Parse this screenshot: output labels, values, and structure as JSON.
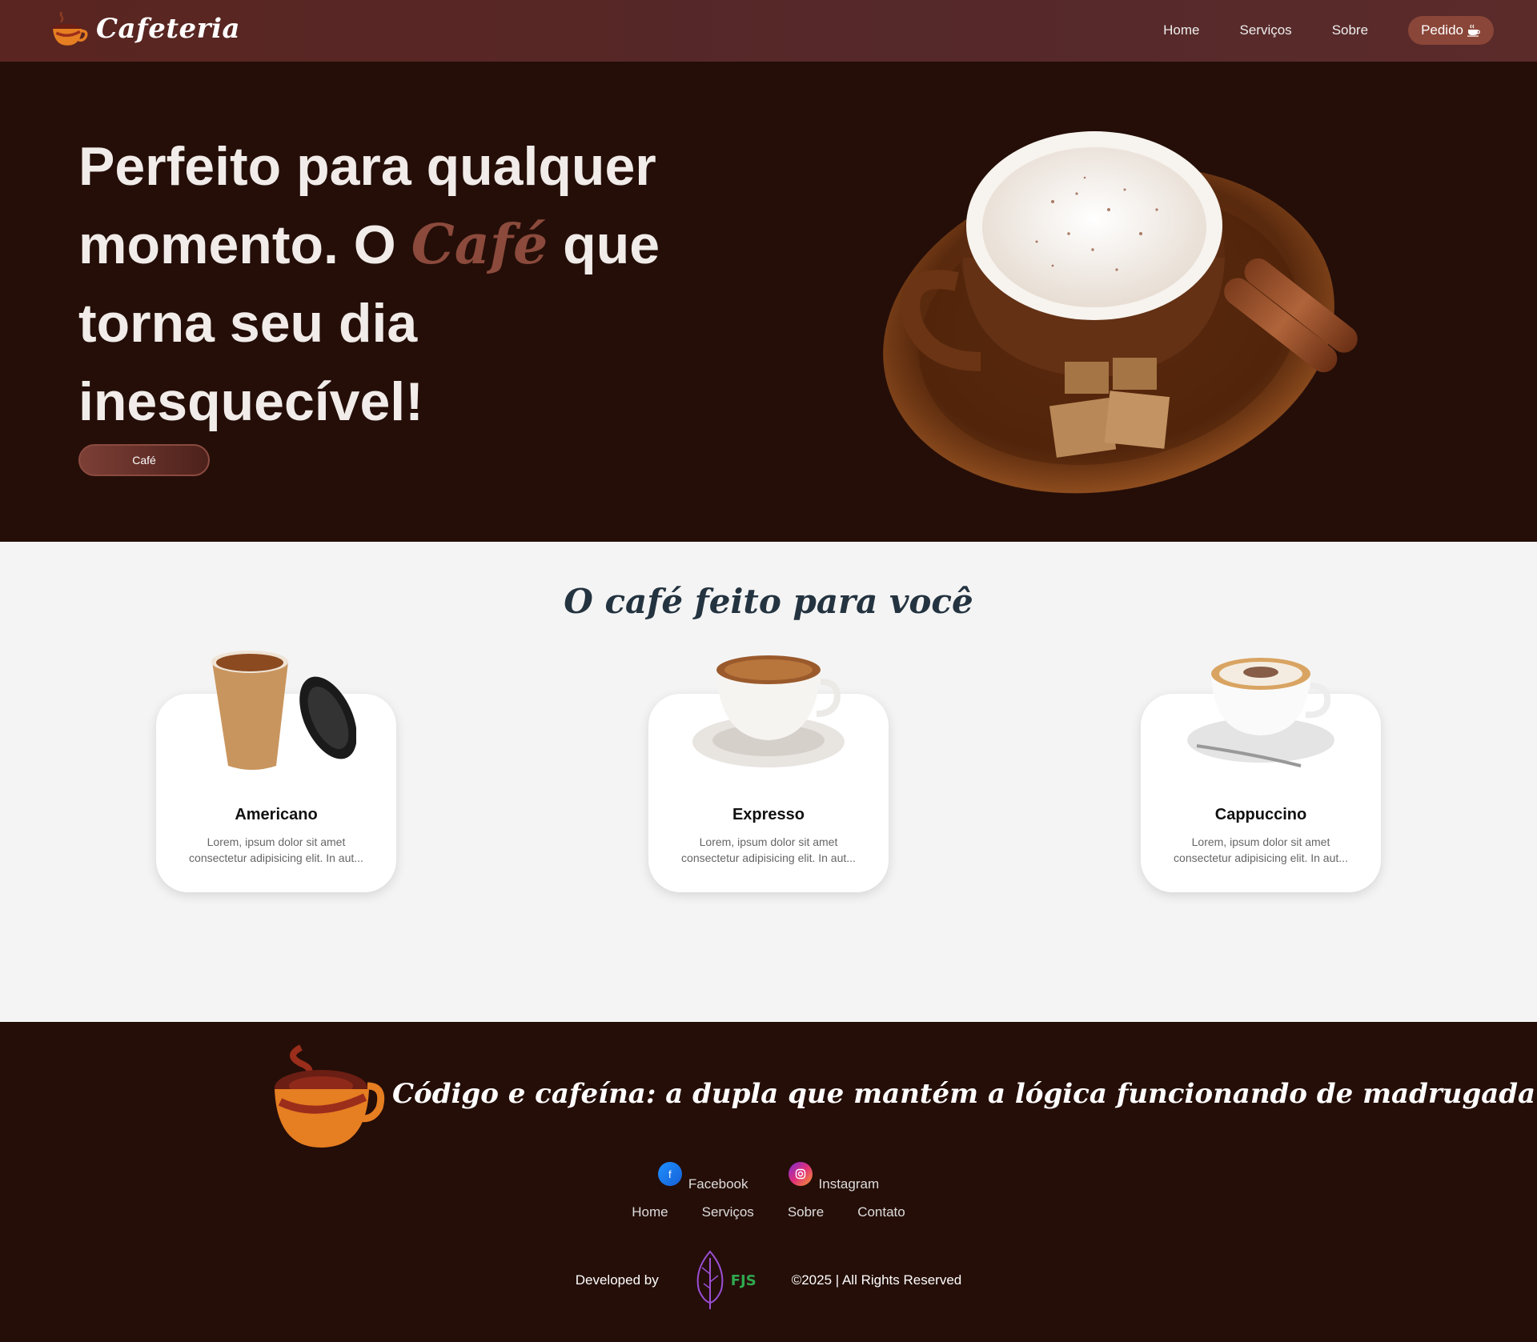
{
  "nav": {
    "brand": "Cafeteria",
    "links": [
      "Home",
      "Serviços",
      "Sobre"
    ],
    "order_label": "Pedido"
  },
  "hero": {
    "title_part1": "Perfeito para qualquer momento. O ",
    "title_accent": "Café",
    "title_part2": " que torna seu dia inesquecível!",
    "button_label": "Café"
  },
  "products": {
    "title": "O café feito para você",
    "items": [
      {
        "name": "Americano",
        "description": "Lorem, ipsum dolor sit amet consectetur adipisicing elit. In aut..."
      },
      {
        "name": "Expresso",
        "description": "Lorem, ipsum dolor sit amet consectetur adipisicing elit. In aut..."
      },
      {
        "name": "Cappuccino",
        "description": "Lorem, ipsum dolor sit amet consectetur adipisicing elit. In aut..."
      }
    ]
  },
  "footer": {
    "slogan": "Código e cafeína: a dupla que mantém a lógica funcionando de madrugada.",
    "socials": [
      {
        "label": "Facebook",
        "icon": "facebook-icon"
      },
      {
        "label": "Instagram",
        "icon": "instagram-icon"
      }
    ],
    "links": [
      "Home",
      "Serviços",
      "Sobre",
      "Contato"
    ],
    "developed_by": "Developed by",
    "dev_logo_text": "FJS",
    "copyright": "©2025 | All Rights Reserved"
  },
  "colors": {
    "nav_bg": "#55282a",
    "hero_bg": "#250e08",
    "accent": "#8b4a3c",
    "section_bg": "#f4f4f4",
    "title_dark": "#243340"
  }
}
